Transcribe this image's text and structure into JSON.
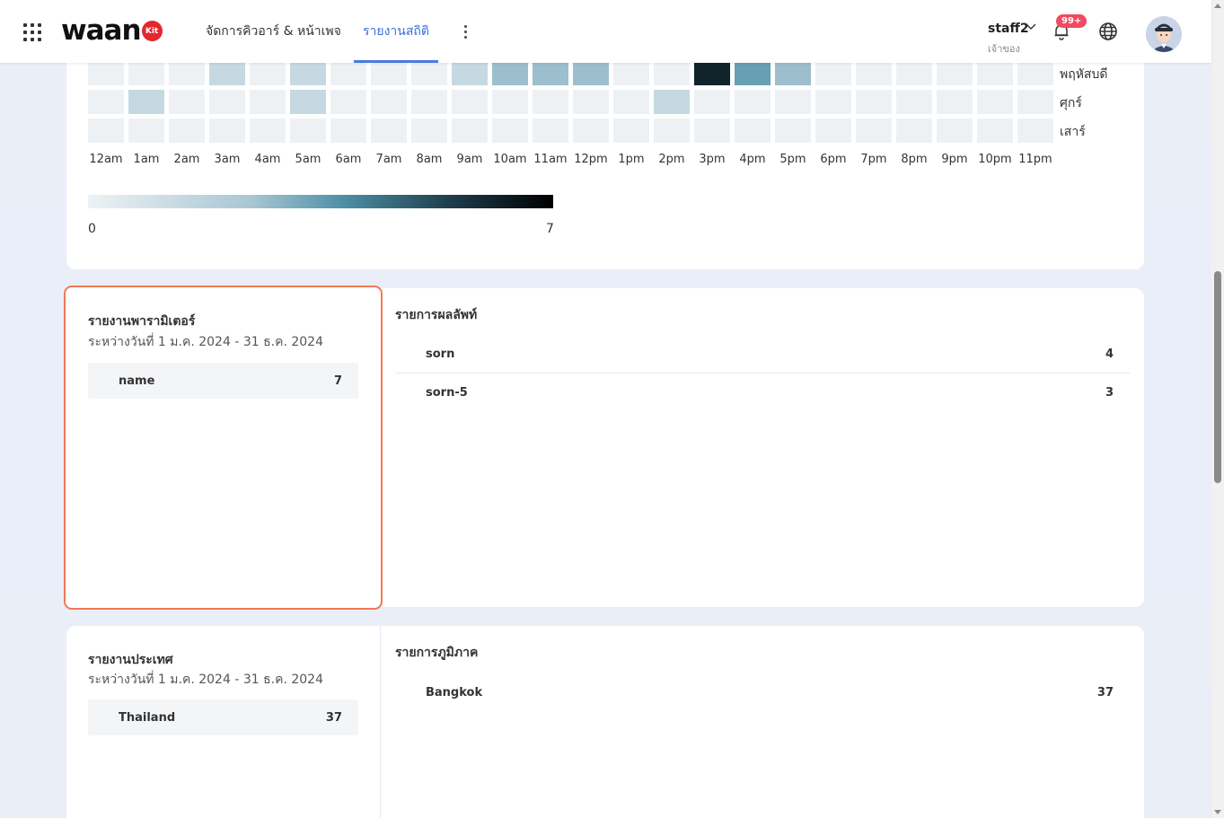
{
  "header": {
    "logo_text": "waan",
    "logo_badge": "Kit",
    "tabs": [
      {
        "label": "จัดการคิวอาร์ & หน้าเพจ"
      },
      {
        "label": "รายงานสถิติ",
        "active": true
      }
    ],
    "user": {
      "name": "staff2",
      "role": "เจ้าของ"
    },
    "notification_count": "99+",
    "icons": [
      "apps-grid-icon",
      "more-vertical-icon",
      "chevron-down-icon",
      "bell-icon",
      "globe-icon",
      "avatar"
    ]
  },
  "heatmap": {
    "days": [
      "พฤหัสบดี",
      "ศุกร์",
      "เสาร์"
    ],
    "hours": [
      "12am",
      "1am",
      "2am",
      "3am",
      "4am",
      "5am",
      "6am",
      "7am",
      "8am",
      "9am",
      "10am",
      "11am",
      "12pm",
      "1pm",
      "2pm",
      "3pm",
      "4pm",
      "5pm",
      "6pm",
      "7pm",
      "8pm",
      "9pm",
      "10pm",
      "11pm"
    ],
    "values": [
      [
        0,
        0,
        0,
        1,
        0,
        1,
        0,
        0,
        0,
        1,
        2,
        2,
        2,
        0,
        0,
        6,
        3,
        2,
        0,
        0,
        0,
        0,
        0,
        0
      ],
      [
        0,
        1,
        0,
        0,
        0,
        1,
        0,
        0,
        0,
        0,
        0,
        0,
        0,
        0,
        1,
        0,
        0,
        0,
        0,
        0,
        0,
        0,
        0,
        0
      ],
      [
        0,
        0,
        0,
        0,
        0,
        0,
        0,
        0,
        0,
        0,
        0,
        0,
        0,
        0,
        0,
        0,
        0,
        0,
        0,
        0,
        0,
        0,
        0,
        0
      ]
    ],
    "legend_min": "0",
    "legend_max": "7",
    "color_scale": [
      "#edf2f5",
      "#a9c6d3",
      "#4d8fa6",
      "#1e3d4b",
      "#000000"
    ]
  },
  "param_report": {
    "title": "รายงานพารามิเตอร์",
    "date_range": "ระหว่างวันที่ 1 ม.ค. 2024 - 31 ธ.ค. 2024",
    "rows": [
      {
        "label": "name",
        "value": "7"
      }
    ]
  },
  "results": {
    "title": "รายการผลลัพท์",
    "rows": [
      {
        "label": "sorn",
        "value": "4"
      },
      {
        "label": "sorn-5",
        "value": "3"
      }
    ]
  },
  "country_report": {
    "title": "รายงานประเทศ",
    "date_range": "ระหว่างวันที่ 1 ม.ค. 2024 - 31 ธ.ค. 2024",
    "rows": [
      {
        "label": "Thailand",
        "value": "37"
      }
    ]
  },
  "regions": {
    "title": "รายการภูมิภาค",
    "rows": [
      {
        "label": "Bangkok",
        "value": "37"
      }
    ]
  },
  "highlight_color": "#f07a52",
  "accent_color": "#3b6fd8"
}
